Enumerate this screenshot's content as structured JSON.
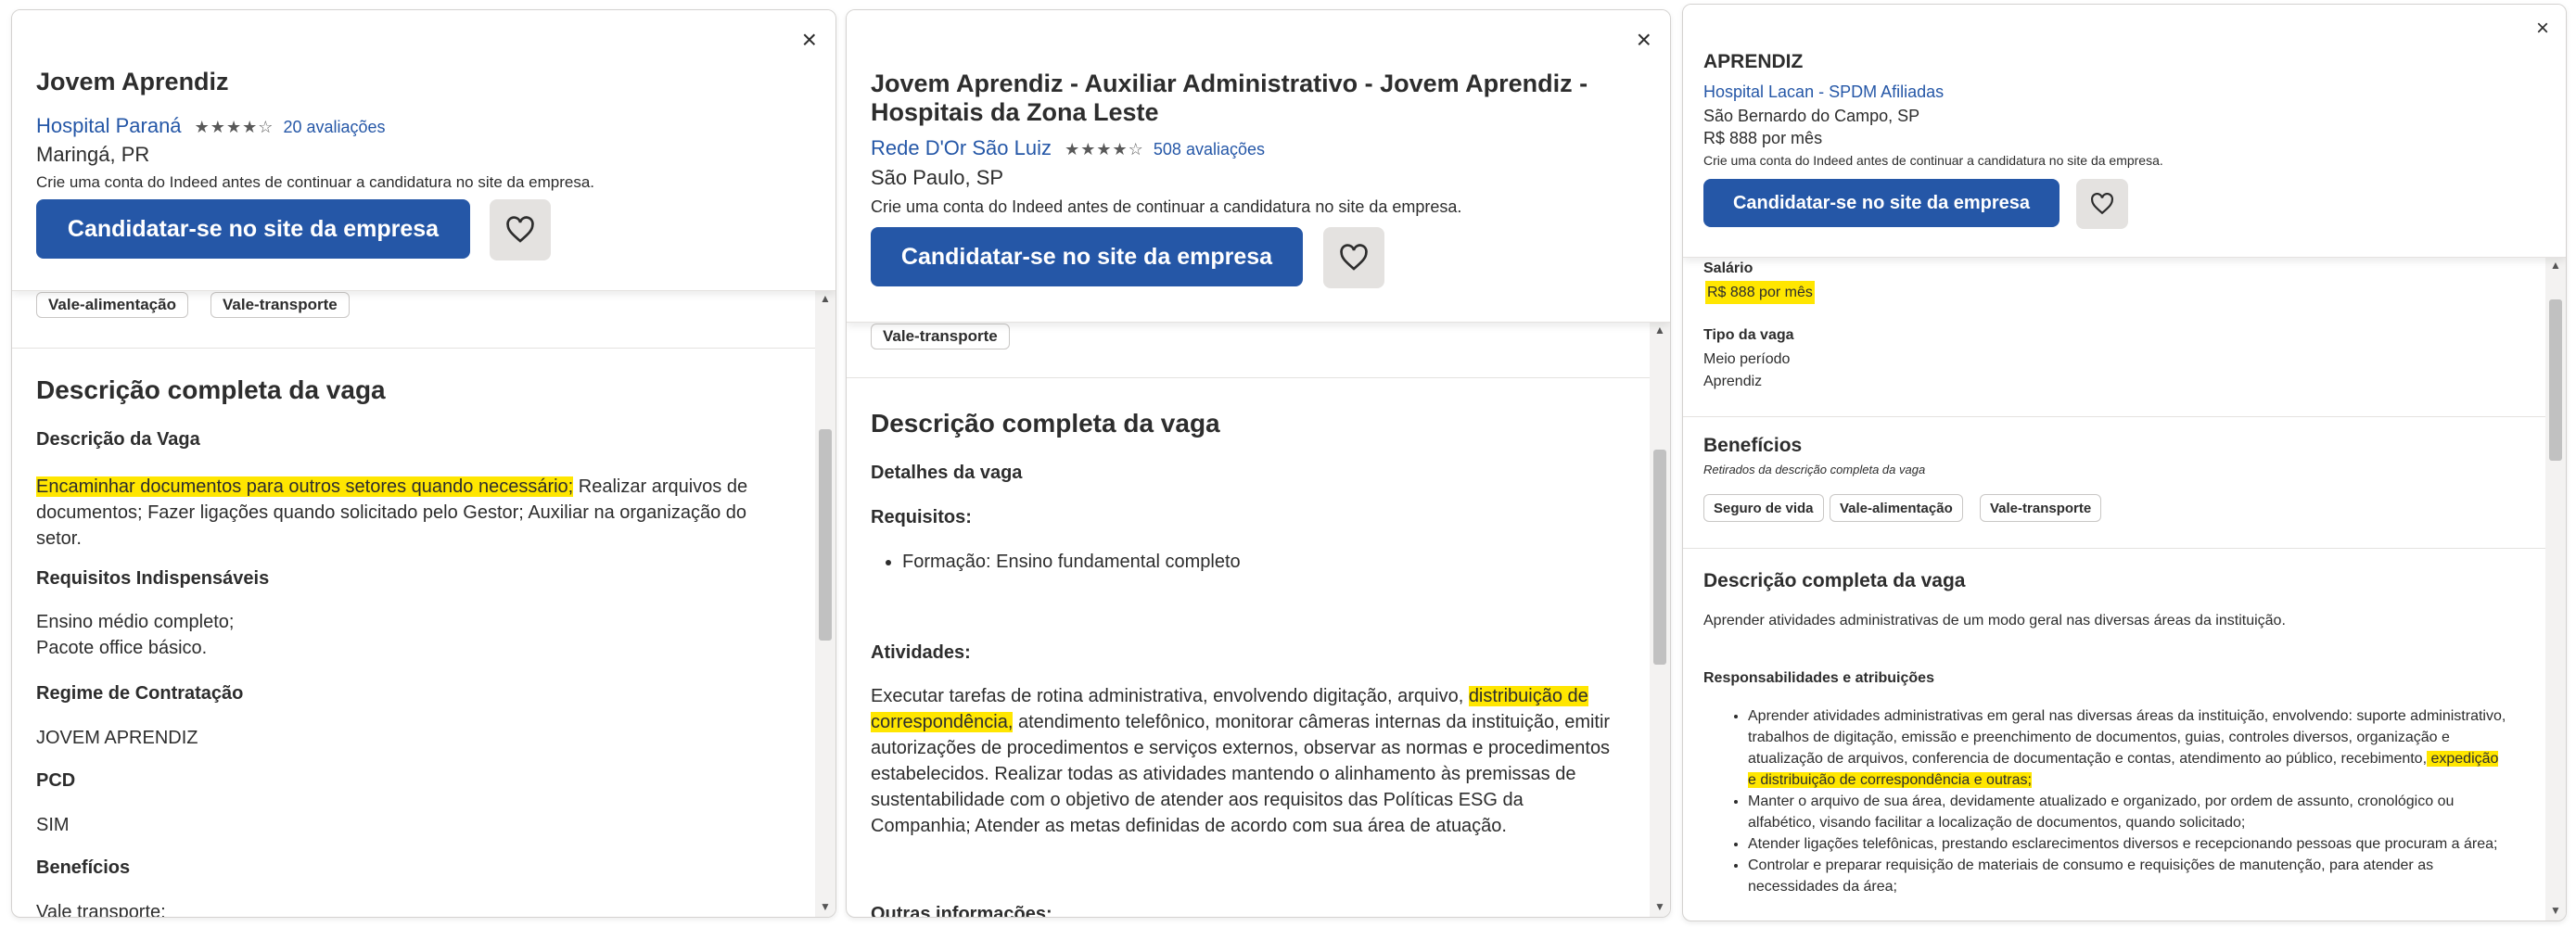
{
  "panel1": {
    "close_icon": "×",
    "title": "Jovem Aprendiz",
    "company": "Hospital Paraná",
    "stars": "★★★★☆",
    "reviews": "20 avaliações",
    "location": "Maringá, PR",
    "notice": "Crie uma conta do Indeed antes de continuar a candidatura no site da empresa.",
    "apply_label": "Candidatar-se no site da empresa",
    "benefit_chips": [
      "Vale-alimentação",
      "Vale-transporte"
    ],
    "section_title": "Descrição completa da vaga",
    "desc_heading": "Descrição da Vaga",
    "desc_highlight": "Encaminhar documentos para outros setores quando necessário;",
    "desc_rest": " Realizar arquivos de documentos; Fazer ligações quando solicitado pelo Gestor; Auxiliar na organização do setor.",
    "req_heading": "Requisitos Indispensáveis",
    "req_line1": "Ensino médio completo;",
    "req_line2": "Pacote office básico.",
    "regime_heading": "Regime de Contratação",
    "regime_value": "JOVEM APRENDIZ",
    "pcd_heading": "PCD",
    "pcd_value": "SIM",
    "benefits_heading": "Benefícios",
    "benefits_value": "Vale transporte;"
  },
  "panel2": {
    "close_icon": "×",
    "title": "Jovem Aprendiz - Auxiliar Administrativo - Jovem Aprendiz - Hospitais da Zona Leste",
    "company": "Rede D'Or São Luiz",
    "stars": "★★★★☆",
    "reviews": "508 avaliações",
    "location": "São Paulo, SP",
    "notice": "Crie uma conta do Indeed antes de continuar a candidatura no site da empresa.",
    "apply_label": "Candidatar-se no site da empresa",
    "benefit_chip": "Vale-transporte",
    "section_title": "Descrição completa da vaga",
    "details_heading": "Detalhes da vaga",
    "req_heading": "Requisitos:",
    "req_item": "Formação: Ensino fundamental completo",
    "activities_heading": "Atividades:",
    "act_part1": "Executar tarefas de rotina administrativa, envolvendo digitação, arquivo, ",
    "act_highlight": "distribuição de correspondência,",
    "act_part2": " atendimento telefônico, monitorar câmeras internas da instituição, emitir autorizações de procedimentos e serviços externos, observar as normas e procedimentos estabelecidos. Realizar todas as atividades mantendo o alinhamento às premissas de sustentabilidade com o objetivo de atender aos requisitos das Políticas ESG da Companhia; Atender as metas definidas de acordo com sua área de atuação.",
    "other_heading": "Outras informações:"
  },
  "panel3": {
    "close_icon": "×",
    "title": "APRENDIZ",
    "company": "Hospital Lacan - SPDM Afiliadas",
    "location": "São Bernardo do Campo, SP",
    "salary_header": "R$ 888 por mês",
    "notice": "Crie uma conta do Indeed antes de continuar a candidatura no site da empresa.",
    "apply_label": "Candidatar-se no site da empresa",
    "salary_heading": "Salário",
    "salary_value": "R$ 888 por mês",
    "type_heading": "Tipo da vaga",
    "type_1": "Meio período",
    "type_2": "Aprendiz",
    "benefits_heading": "Benefícios",
    "benefits_sub": "Retirados da descrição completa da vaga",
    "benefit_chips": [
      "Seguro de vida",
      "Vale-alimentação",
      "Vale-transporte"
    ],
    "section_title": "Descrição completa da vaga",
    "intro": "Aprender atividades administrativas de um modo geral nas diversas áreas da instituição.",
    "resp_heading": "Responsabilidades e atribuições",
    "bullet1_part1": "Aprender atividades administrativas em geral nas diversas áreas da instituição, envolvendo: suporte administrativo, trabalhos de digitação, emissão e preenchimento de documentos, guias, controles diversos, organização e atualização de arquivos, conferencia de documentação e contas, atendimento ao público, recebimento,",
    "bullet1_highlight": " expedição e distribuição de correspondência e outras;",
    "bullet2": "Manter o arquivo de sua área, devidamente atualizado e organizado, por ordem de assunto, cronológico ou alfabético, visando facilitar a localização de documentos, quando solicitado;",
    "bullet3": "Atender ligações telefônicas, prestando esclarecimentos diversos e recepcionando pessoas que procuram a área;",
    "bullet4": "Controlar e preparar requisição de materiais de consumo e requisições de manutenção, para atender as necessidades da área;"
  },
  "colors": {
    "accent": "#2557a7",
    "highlight": "#ffe600",
    "text": "#2d2d2d"
  }
}
